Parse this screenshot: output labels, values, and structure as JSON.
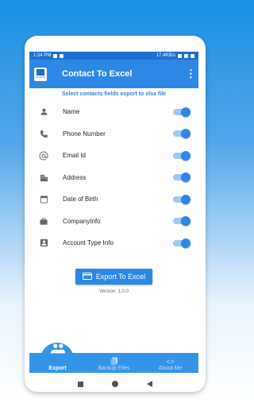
{
  "status": {
    "time": "1:24 PM",
    "right": "17.4KB/s"
  },
  "app": {
    "title": "Contact To Excel",
    "logo_text": "Contacts",
    "menu": "⋮"
  },
  "subtitle": "Select contacts fields export to xlsx file",
  "fields": [
    {
      "label": "Name",
      "icon": "person-icon",
      "enabled": true
    },
    {
      "label": "Phone Number",
      "icon": "phone-icon",
      "enabled": true
    },
    {
      "label": "Email Id",
      "icon": "at-icon",
      "enabled": true
    },
    {
      "label": "Address",
      "icon": "building-icon",
      "enabled": true
    },
    {
      "label": "Date of Birth",
      "icon": "calendar-icon",
      "enabled": true
    },
    {
      "label": "CompanyInfo",
      "icon": "briefcase-icon",
      "enabled": true
    },
    {
      "label": "Account Type Info",
      "icon": "account-box-icon",
      "enabled": true
    }
  ],
  "export_button": "Export To Excel",
  "version": "Version: 1.0.0",
  "nav": [
    {
      "label": "Export",
      "icon": "group-icon"
    },
    {
      "label": "Backup Files",
      "icon": "files-icon"
    },
    {
      "label": "About Me",
      "icon": "code-icon"
    }
  ],
  "nav_code_glyph": "<>",
  "colors": {
    "primary": "#2d87e6",
    "status_bar": "#1e6fd0"
  }
}
